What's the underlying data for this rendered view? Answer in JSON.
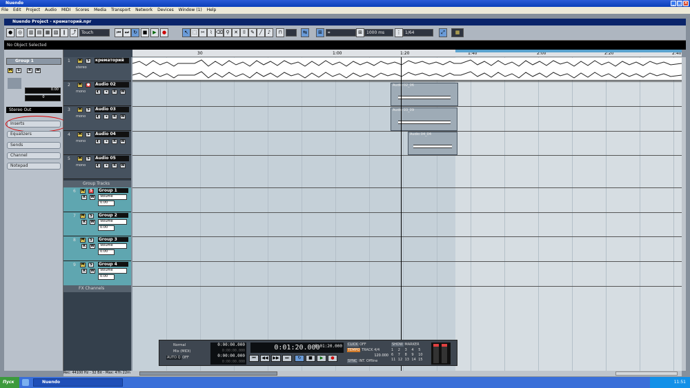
{
  "window": {
    "app_title": "Nuendo"
  },
  "menu": [
    "File",
    "Edit",
    "Project",
    "Audio",
    "MIDI",
    "Scores",
    "Media",
    "Transport",
    "Network",
    "Devices",
    "Window (1)",
    "Help"
  ],
  "project": {
    "title": "Nuendo Project - крематорий.npr",
    "info_line": "No Object Selected"
  },
  "toolbar": {
    "automation_mode": "Touch",
    "nudge": "1000 ms",
    "quantize": "1/64"
  },
  "ruler": {
    "ticks": [
      "30",
      "1:00",
      "1:20",
      "1:40",
      "2:00",
      "2:20",
      "2:40"
    ]
  },
  "inspector": {
    "group_name": "Group 1",
    "value1": "0.00",
    "value2": "0",
    "output": "Stereo Out",
    "sections": [
      "Inserts",
      "Equalizers",
      "Sends",
      "Channel",
      "Notepad"
    ]
  },
  "tracks": [
    {
      "num": "1",
      "name": "крематорий",
      "type": "stereo"
    },
    {
      "num": "2",
      "name": "Audio 02",
      "type": "mono"
    },
    {
      "num": "3",
      "name": "Audio 03",
      "type": "mono"
    },
    {
      "num": "4",
      "name": "Audio 04",
      "type": "mono"
    },
    {
      "num": "5",
      "name": "Audio 05",
      "type": "mono"
    }
  ],
  "group_folder": "Group Tracks",
  "group_tracks": [
    {
      "num": "6",
      "name": "Group 1",
      "param": "Volume",
      "value": "0.00"
    },
    {
      "num": "7",
      "name": "Group 2",
      "param": "Volume",
      "value": "0.00"
    },
    {
      "num": "8",
      "name": "Group 3",
      "param": "Volume",
      "value": "0.00"
    },
    {
      "num": "9",
      "name": "Group 4",
      "param": "Volume",
      "value": "0.00"
    }
  ],
  "fx_folder": "FX Channels",
  "clips": [
    "Audio 02_06",
    "Audio 03_09",
    "Audio 04_04"
  ],
  "status_bar": "Rec: 44100 Hz - 32 Bit - Max: 47h 22m",
  "transport": {
    "mode1": "Normal",
    "mode2": "Mix (MIDI)",
    "autoq": "AUTO Q",
    "autoq_val": "OFF",
    "left_locator": "0:00:00.000",
    "right_locator": "0:00:00.000",
    "left_small": "0:00:00.000",
    "right_small": "0:00:00.000",
    "position_main": "0:01:20.000",
    "position_sub": "0:01:20.000",
    "click": "CLICK",
    "click_val": "OFF",
    "tempo": "TEMPO",
    "tempo_track": "TRACK",
    "signature": "4/4",
    "bpm": "120.000",
    "sync": "SYNC",
    "sync_int": "INT.",
    "sync_offline": "Offline",
    "show": "SHOW",
    "marker": "MARKER",
    "marker_nums": [
      "1",
      "2",
      "3",
      "4",
      "5",
      "6",
      "7",
      "8",
      "9",
      "10",
      "11",
      "12",
      "13",
      "14",
      "15"
    ]
  },
  "taskbar": {
    "start": "Пуск",
    "app": "Nuendo",
    "clock": "11:51"
  },
  "colors": {
    "mute": "#e8d05a",
    "record": "#e04040",
    "group_track": "#5fa6b0",
    "titlebar": "#0a3fb8"
  }
}
